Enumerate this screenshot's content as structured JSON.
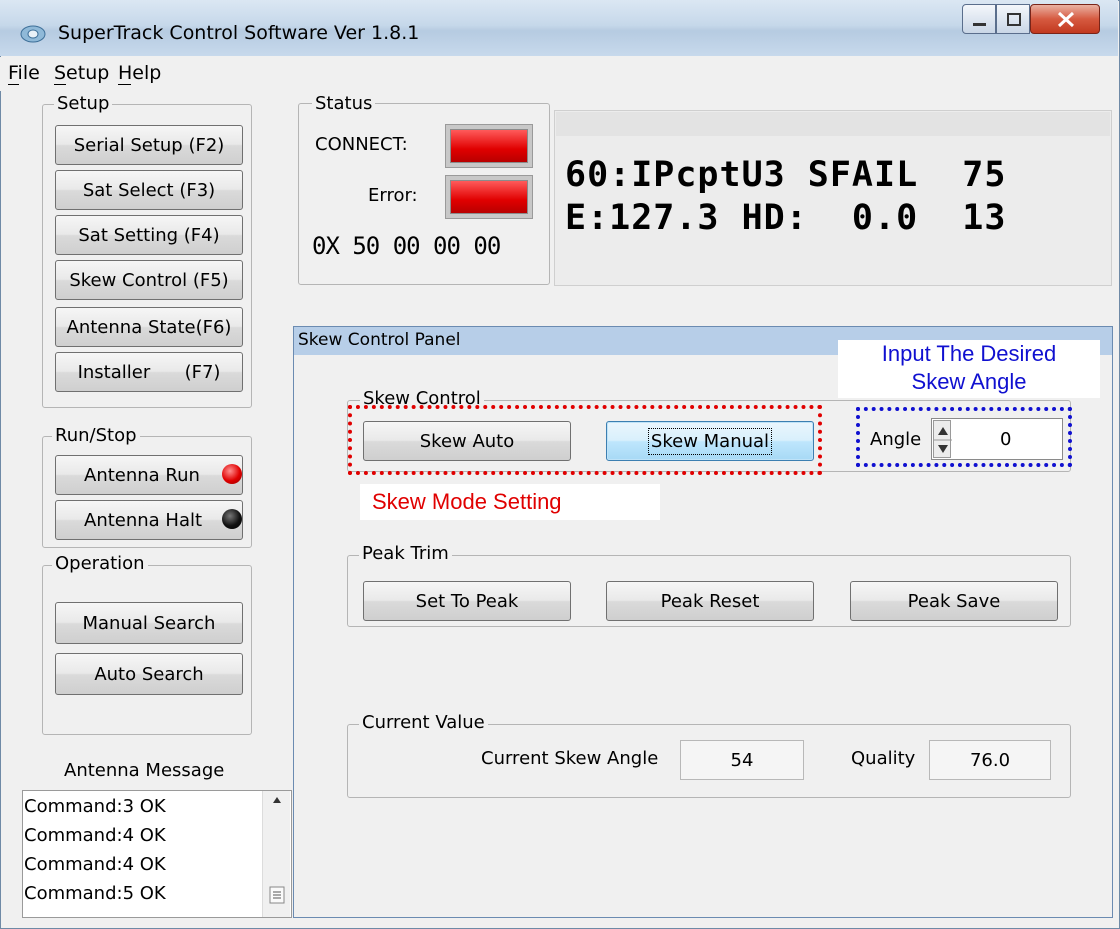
{
  "window": {
    "title": "SuperTrack Control Software Ver 1.8.1",
    "menu": [
      "File",
      "Setup",
      "Help"
    ]
  },
  "setup": {
    "label": "Setup",
    "buttons": [
      "Serial Setup (F2)",
      "Sat Select  (F3)",
      "Sat Setting  (F4)",
      "Skew Control (F5)",
      "Antenna State(F6)",
      "Installer      (F7)"
    ]
  },
  "runstop": {
    "label": "Run/Stop",
    "run": "Antenna Run",
    "halt": "Antenna Halt",
    "run_led_color": "#e00000",
    "halt_led_color": "#111111"
  },
  "operation": {
    "label": "Operation",
    "manual": "Manual Search",
    "auto": "Auto Search"
  },
  "messages": {
    "label": "Antenna Message",
    "lines": [
      "Command:3 OK",
      "Command:4 OK",
      "Command:4 OK",
      "Command:5 OK"
    ]
  },
  "status": {
    "label": "Status",
    "connect": "CONNECT:",
    "error": "Error:",
    "code": "0X 50 00 00 00",
    "led_color": "#e00000"
  },
  "lcd": {
    "line1": "60:IPcptU3 SFAIL  75",
    "line2": "E:127.3 HD:  0.0  13"
  },
  "panel": {
    "title": "Skew Control Panel",
    "skew_group": "Skew Control",
    "skew_auto": "Skew Auto",
    "skew_manual": "Skew Manual",
    "angle_label": "Angle",
    "angle_value": "0",
    "peak_group": "Peak Trim",
    "set_to_peak": "Set To Peak",
    "peak_reset": "Peak Reset",
    "peak_save": "Peak Save",
    "current_group": "Current Value",
    "current_skew_label": "Current Skew Angle",
    "current_skew_value": "54",
    "quality_label": "Quality",
    "quality_value": "76.0"
  },
  "annotations": {
    "angle_note_line1": "Input The Desired",
    "angle_note_line2": "Skew Angle",
    "mode_note": "Skew Mode Setting",
    "red": "#e00000",
    "blue": "#1010d0"
  }
}
